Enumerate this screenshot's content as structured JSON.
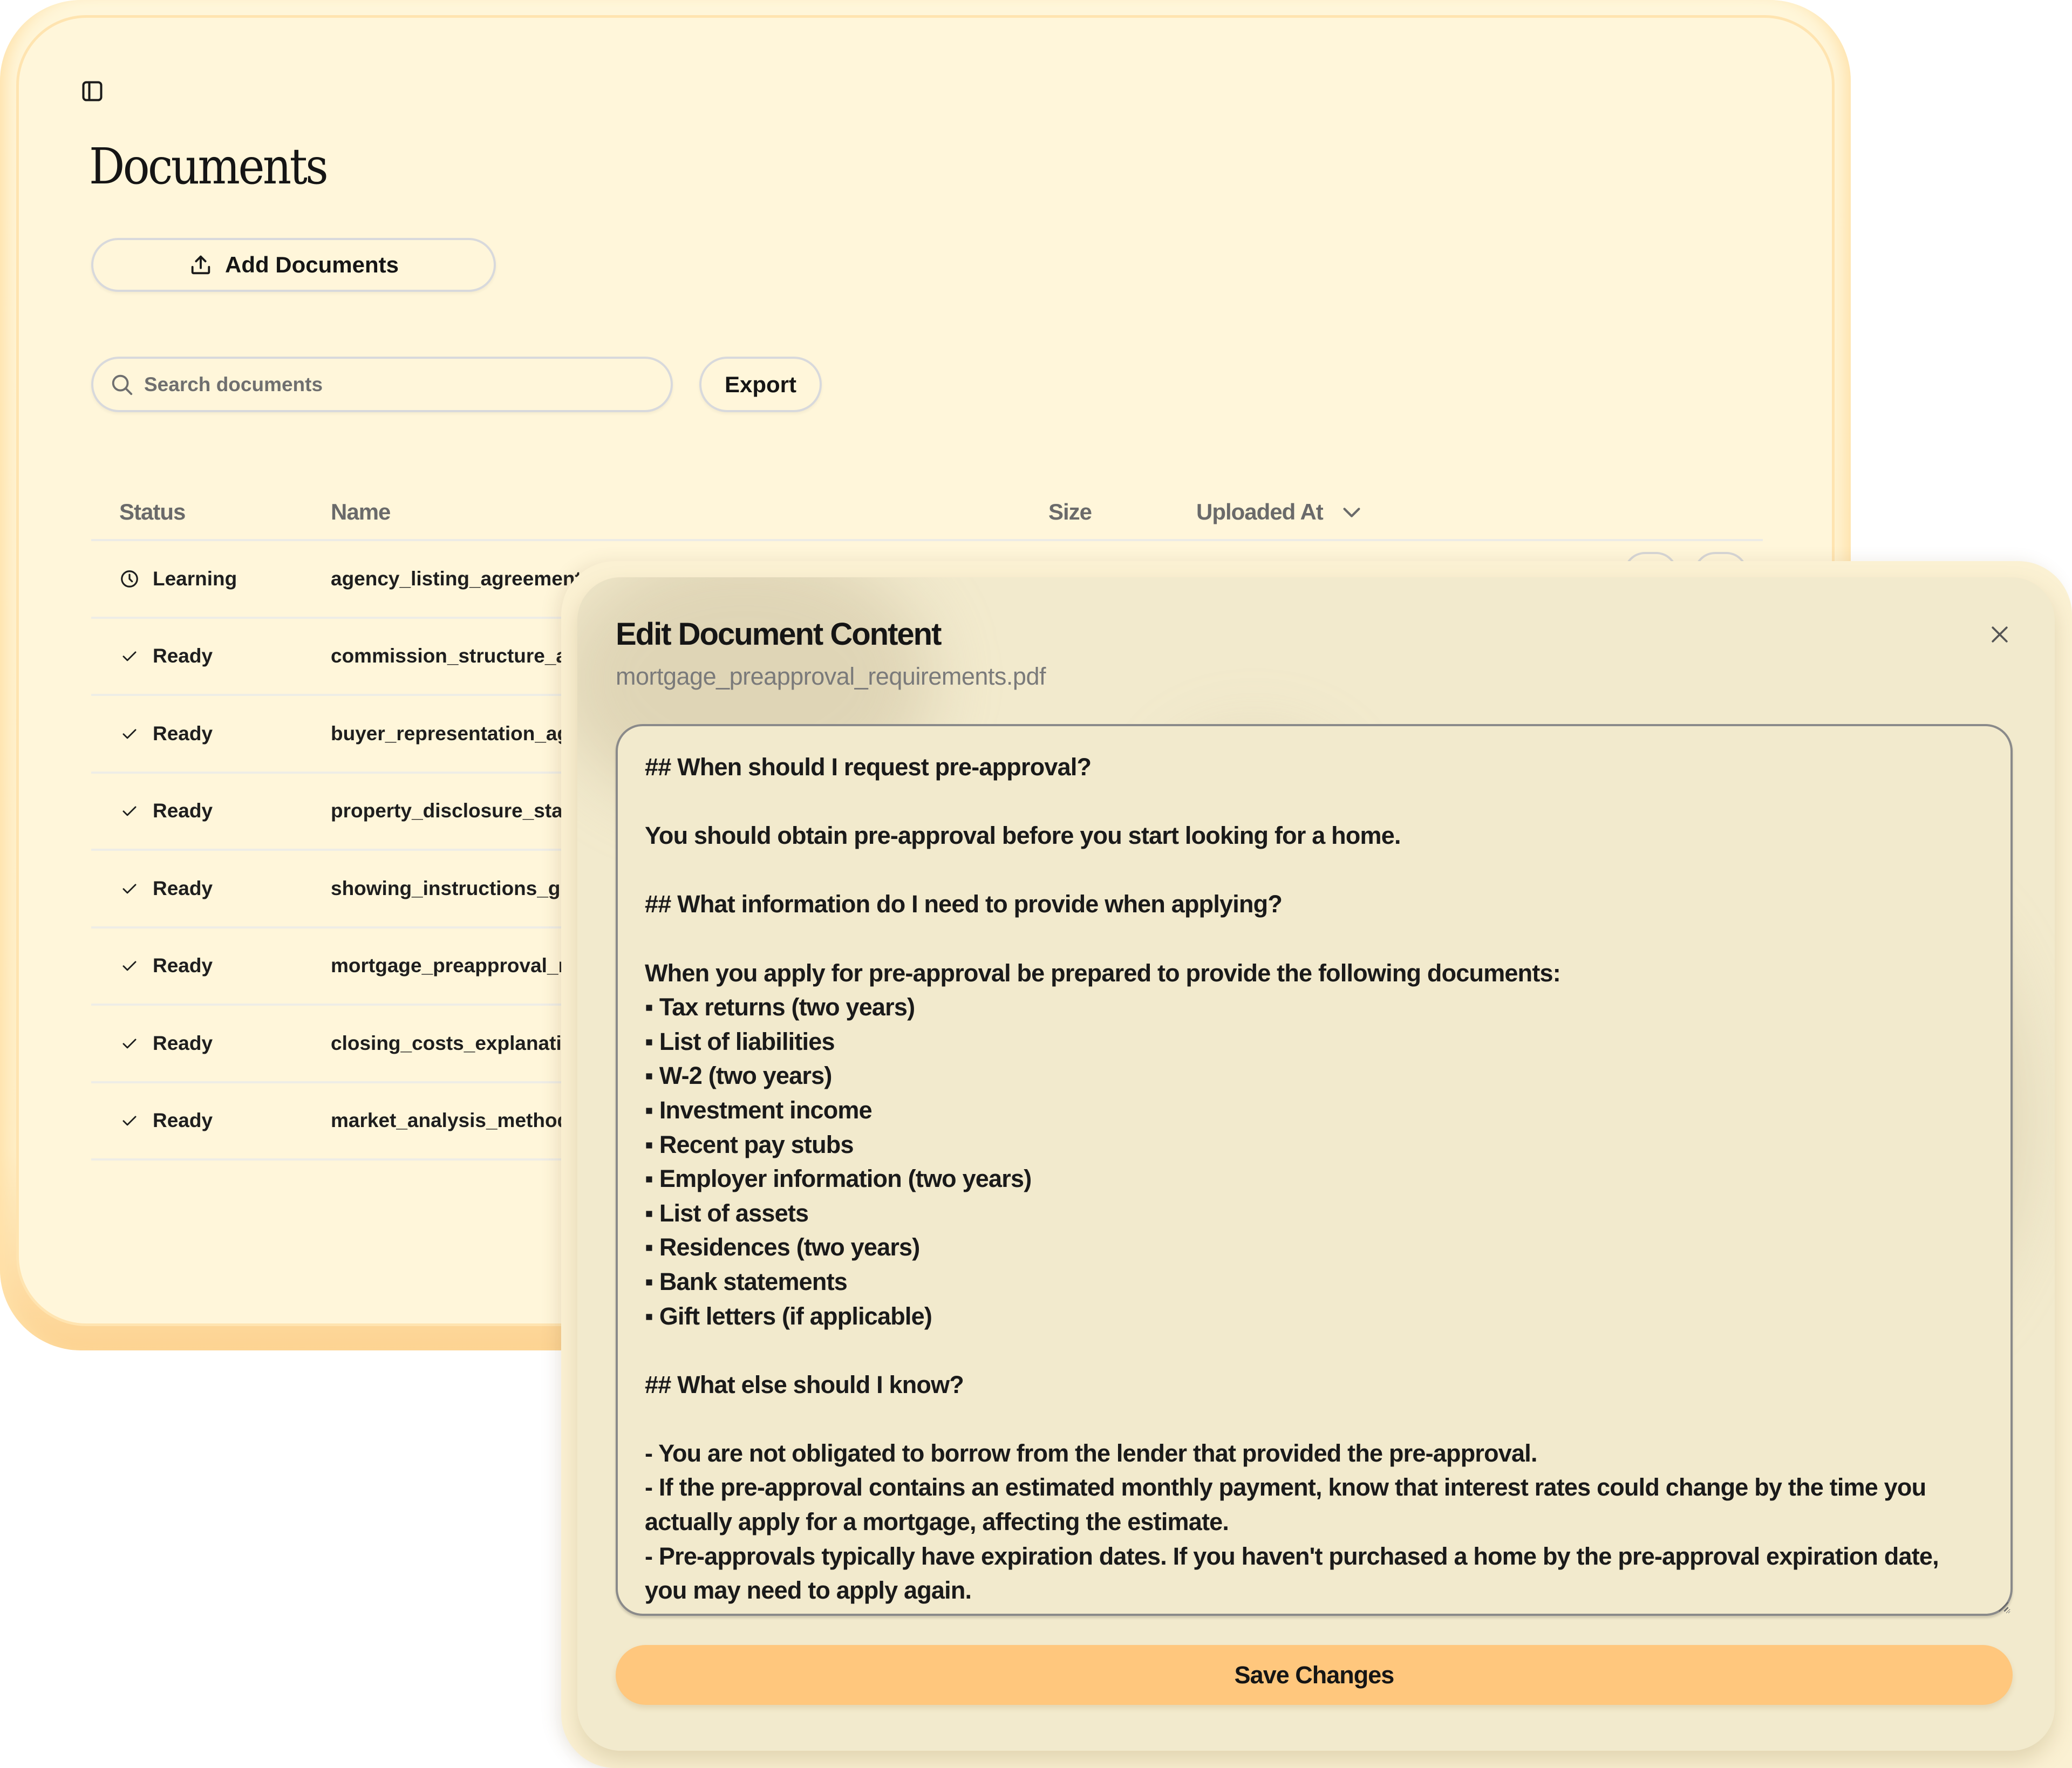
{
  "page": {
    "title": "Documents",
    "sidebar_toggle_icon": "sidebar-panel-icon"
  },
  "toolbar": {
    "add_documents_label": "Add Documents",
    "add_documents_icon": "upload-icon",
    "search_placeholder": "Search documents",
    "search_value": "",
    "export_label": "Export"
  },
  "table": {
    "columns": {
      "status": "Status",
      "name": "Name",
      "size": "Size",
      "uploaded_at": "Uploaded At"
    },
    "sort": {
      "column": "uploaded_at",
      "direction": "desc"
    },
    "rows": [
      {
        "status": "Learning",
        "status_icon": "clock-icon",
        "name": "agency_listing_agreement_t"
      },
      {
        "status": "Ready",
        "status_icon": "check-icon",
        "name": "commission_structure_and"
      },
      {
        "status": "Ready",
        "status_icon": "check-icon",
        "name": "buyer_representation_agre"
      },
      {
        "status": "Ready",
        "status_icon": "check-icon",
        "name": "property_disclosure_stater"
      },
      {
        "status": "Ready",
        "status_icon": "check-icon",
        "name": "showing_instructions_guide"
      },
      {
        "status": "Ready",
        "status_icon": "check-icon",
        "name": "mortgage_preapproval_req"
      },
      {
        "status": "Ready",
        "status_icon": "check-icon",
        "name": "closing_costs_explanation.p"
      },
      {
        "status": "Ready",
        "status_icon": "check-icon",
        "name": "market_analysis_methodol"
      }
    ]
  },
  "modal": {
    "title": "Edit Document Content",
    "filename": "mortgage_preapproval_requirements.pdf",
    "close_icon": "close-icon",
    "content": "## When should I request pre-approval?\n\nYou should obtain pre-approval before you start looking for a home.\n\n## What information do I need to provide when applying?\n\nWhen you apply for pre-approval be prepared to provide the following documents:\n▪ Tax returns (two years)\n▪ List of liabilities\n▪ W-2 (two years)\n▪ Investment income\n▪ Recent pay stubs\n▪ Employer information (two years)\n▪ List of assets\n▪ Residences (two years)\n▪ Bank statements\n▪ Gift letters (if applicable)\n\n## What else should I know?\n\n- You are not obligated to borrow from the lender that provided the pre-approval.\n- If the pre-approval contains an estimated monthly payment, know that interest rates could change by the time you actually apply for a mortgage, affecting the estimate.\n- Pre-approvals typically have expiration dates. If you haven't purchased a home by the pre-approval expiration date, you may need to apply again.",
    "save_label": "Save Changes"
  },
  "colors": {
    "page_background": "#FFF6DA",
    "modal_background": "#F2EACD",
    "accent": "#FFC77D",
    "muted_text": "#6A6A6A",
    "text": "#151515"
  }
}
